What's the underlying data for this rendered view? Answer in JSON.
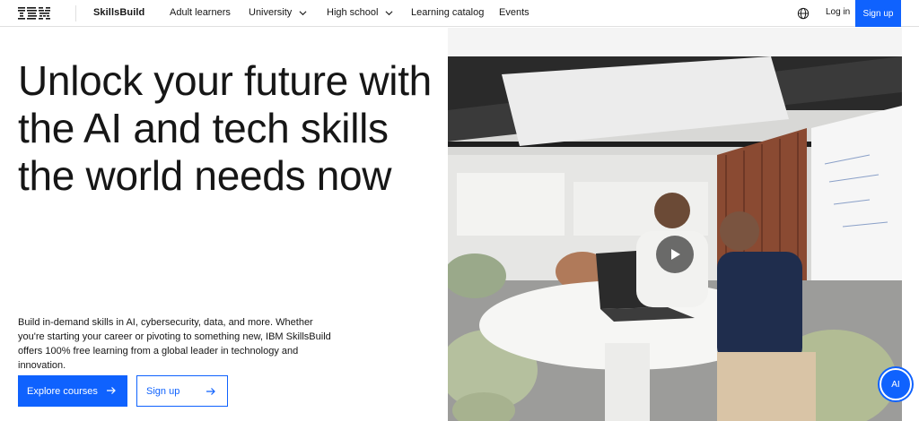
{
  "nav": {
    "logo_text": "IBM",
    "brand": "SkillsBuild",
    "links": [
      {
        "label": "Adult learners",
        "has_dropdown": false
      },
      {
        "label": "University",
        "has_dropdown": true
      },
      {
        "label": "High school",
        "has_dropdown": true
      },
      {
        "label": "Learning catalog",
        "has_dropdown": false
      },
      {
        "label": "Events",
        "has_dropdown": false
      }
    ],
    "globe_icon": "globe-icon",
    "login_label": "Log in",
    "signup_label": "Sign up"
  },
  "hero": {
    "title": "Unlock your future with the AI and tech skills the world needs now",
    "description": "Build in-demand skills in AI, cybersecurity, data, and more. Whether you're starting your career or pivoting to something new, IBM SkillsBuild offers 100% free learning from a global leader in technology and innovation.",
    "primary_button": "Explore courses",
    "secondary_button": "Sign up",
    "video_icon": "play-icon"
  },
  "assistant": {
    "label": "AI"
  },
  "colors": {
    "accent": "#0f62fe",
    "text": "#161616",
    "divider": "#e0e0e0"
  }
}
